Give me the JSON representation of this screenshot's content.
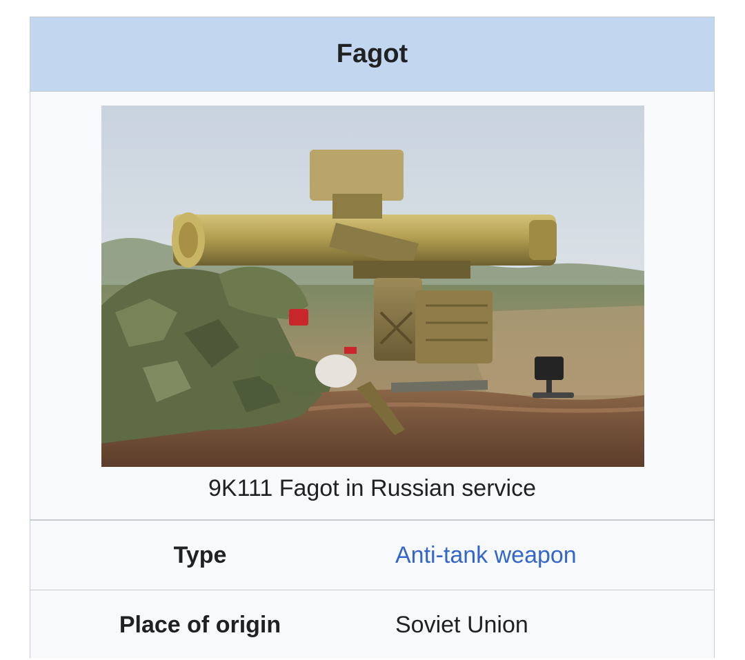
{
  "infobox": {
    "title": "Fagot",
    "image_caption": "9K111 Fagot in Russian service",
    "rows": [
      {
        "label": "Type",
        "value": "Anti-tank weapon",
        "is_link": true
      },
      {
        "label": "Place of origin",
        "value": "Soviet Union",
        "is_link": false
      }
    ]
  },
  "colors": {
    "title_background": "#c3d6ef",
    "infobox_background": "#f8f9fa",
    "border": "#c8ccd1",
    "link": "#3366cc",
    "text": "#202122"
  }
}
